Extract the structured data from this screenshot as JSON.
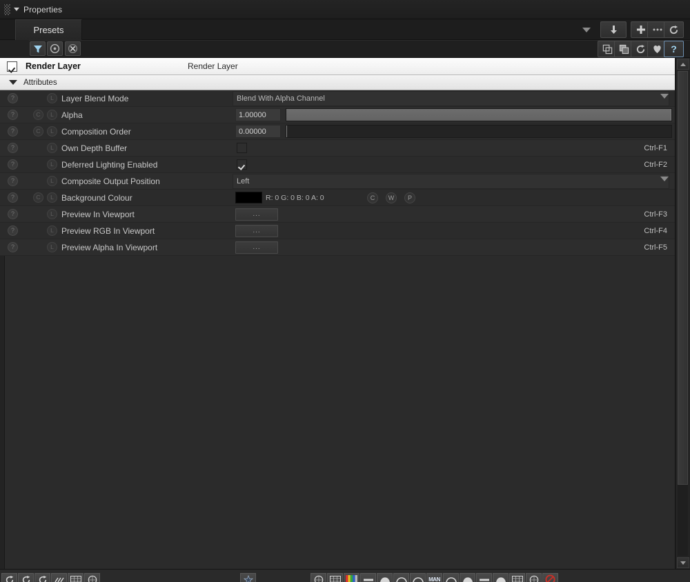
{
  "window": {
    "title": "Properties",
    "grip_icon": "drag-grip-icon",
    "collapse_icon": "triangle-down-icon"
  },
  "tab": {
    "label": "Presets"
  },
  "toolbar": {
    "filter_icon": "funnel-filter-icon",
    "target_icon": "circle-dot-icon",
    "clear_icon": "x-close-icon",
    "dropdown_icon": "triangle-down-icon",
    "import_icon": "arrow-down-icon",
    "add_icon": "plus-icon",
    "more_icon": "ellipsis-icon",
    "reset_icon": "reload-arrow-icon",
    "copy_icon": "copy-layers-icon",
    "paste_icon": "paste-layers-icon",
    "revert_icon": "reload-arrow-icon",
    "favorite_icon": "heart-icon",
    "help_icon": "question-mark-icon"
  },
  "object_header": {
    "checkbox_checked": true,
    "name": "Render Layer",
    "type": "Render Layer"
  },
  "group": {
    "label": "Attributes",
    "expanded": true,
    "twisty_icon": "triangle-down-icon"
  },
  "attributes": [
    {
      "help_icon": "question-circle-icon",
      "connect_icon": null,
      "lock_icon": "lock-circle-icon",
      "label": "Layer Blend Mode",
      "kind": "enum",
      "value": "Blend With Alpha Channel",
      "dropdown_icon": "triangle-down-icon",
      "shortcut": ""
    },
    {
      "help_icon": "question-circle-icon",
      "connect_icon": "connect-circle-icon",
      "lock_icon": "lock-circle-icon",
      "label": "Alpha",
      "kind": "slider",
      "value": "1.00000",
      "fill_percent": 100,
      "shortcut": ""
    },
    {
      "help_icon": "question-circle-icon",
      "connect_icon": "connect-circle-icon",
      "lock_icon": "lock-circle-icon",
      "label": "Composition Order",
      "kind": "slider",
      "value": "0.00000",
      "fill_percent": 0,
      "shortcut": ""
    },
    {
      "help_icon": "question-circle-icon",
      "connect_icon": null,
      "lock_icon": "lock-circle-icon",
      "label": "Own Depth Buffer",
      "kind": "checkbox",
      "checked": false,
      "shortcut": "Ctrl-F1"
    },
    {
      "help_icon": "question-circle-icon",
      "connect_icon": null,
      "lock_icon": "lock-circle-icon",
      "label": "Deferred Lighting Enabled",
      "kind": "checkbox",
      "checked": true,
      "shortcut": "Ctrl-F2"
    },
    {
      "help_icon": "question-circle-icon",
      "connect_icon": null,
      "lock_icon": "lock-circle-icon",
      "label": "Composite Output Position",
      "kind": "enum",
      "value": "Left",
      "dropdown_icon": "triangle-down-icon",
      "shortcut": ""
    },
    {
      "help_icon": "question-circle-icon",
      "connect_icon": "connect-circle-icon",
      "lock_icon": "lock-circle-icon",
      "label": "Background Colour",
      "kind": "colour",
      "swatch_hex": "#000000",
      "rgba_text": "R: 0 G: 0 B: 0 A: 0",
      "buttons": [
        "C",
        "W",
        "P"
      ],
      "shortcut": ""
    },
    {
      "help_icon": "question-circle-icon",
      "connect_icon": null,
      "lock_icon": "lock-circle-icon",
      "label": "Preview In Viewport",
      "kind": "button",
      "button_label": "...",
      "shortcut": "Ctrl-F3"
    },
    {
      "help_icon": "question-circle-icon",
      "connect_icon": null,
      "lock_icon": "lock-circle-icon",
      "label": "Preview RGB In Viewport",
      "kind": "button",
      "button_label": "...",
      "shortcut": "Ctrl-F4"
    },
    {
      "help_icon": "question-circle-icon",
      "connect_icon": null,
      "lock_icon": "lock-circle-icon",
      "label": "Preview Alpha In Viewport",
      "kind": "button",
      "button_label": "...",
      "shortcut": "Ctrl-F5"
    }
  ],
  "scrollbar": {
    "up_icon": "triangle-up-icon",
    "down_icon": "triangle-down-icon"
  },
  "bottom_toolbar": {
    "left_icons": [
      "rotate-icon",
      "orbit-icon",
      "spin-icon",
      "motion-icon",
      "timeline-icon",
      "circle-icon"
    ],
    "mid_icons": [
      "star-gear-icon"
    ],
    "right_icons": [
      "globe-icon",
      "grid-icon",
      "colour-bars-icon",
      "shade-icon",
      "umbrella-icon",
      "blur-icon",
      "fog-icon",
      "man-icon",
      "arc-icon",
      "dome-icon",
      "plane-icon",
      "hemisphere-icon",
      "panel-icon",
      "clock-icon",
      "no-entry-icon"
    ]
  },
  "colors": {
    "panel_bg": "#2b2b2b",
    "header_light": "#f3f3f3",
    "accent_filter": "#9fd3ef",
    "text": "#c8c8c8"
  }
}
